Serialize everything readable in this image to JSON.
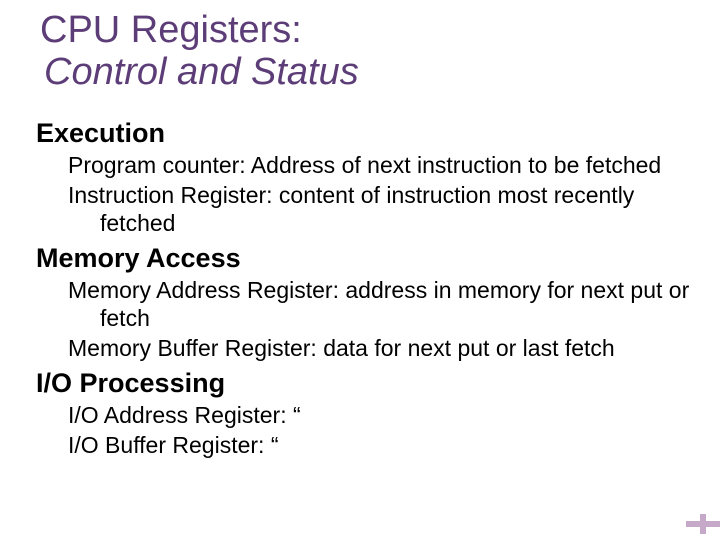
{
  "title": {
    "main": "CPU Registers:",
    "sub": "Control and Status"
  },
  "sections": [
    {
      "heading": "Execution",
      "items": [
        "Program counter:  Address of next instruction to be fetched",
        "Instruction Register:  content of instruction most recently fetched"
      ]
    },
    {
      "heading": "Memory Access",
      "items": [
        "Memory Address Register:  address in memory for next put or fetch",
        "Memory Buffer Register:  data for next put or last fetch"
      ]
    },
    {
      "heading": "I/O Processing",
      "items": [
        "I/O Address Register:  “",
        "I/O Buffer Register:   “"
      ]
    }
  ]
}
